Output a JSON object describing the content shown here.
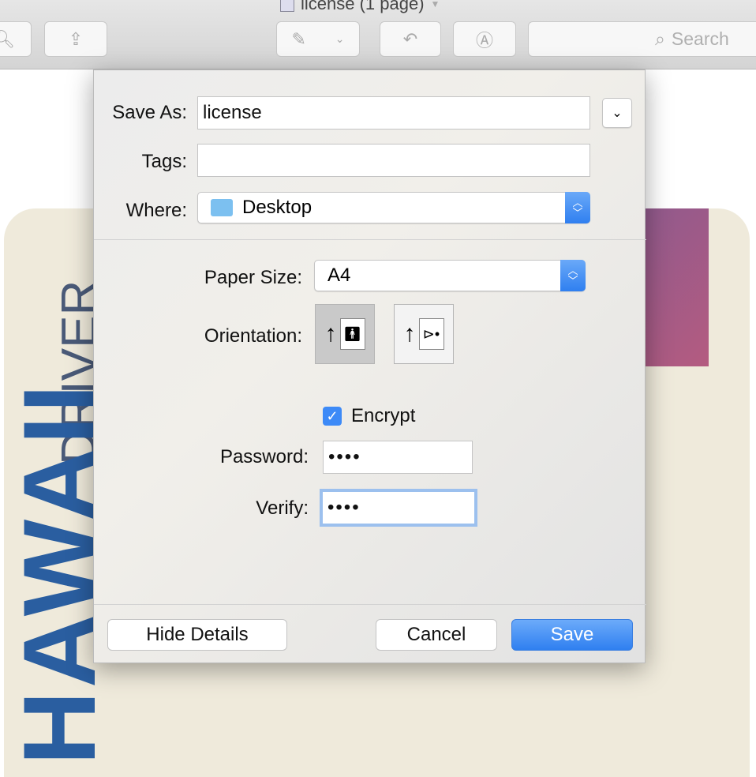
{
  "window": {
    "title": "license (1 page)"
  },
  "toolbar": {
    "search_placeholder": "Search"
  },
  "document": {
    "text_1": "DRIVER",
    "text_2": "HAWAII"
  },
  "dialog": {
    "save_as_label": "Save As:",
    "save_as_value": "license",
    "tags_label": "Tags:",
    "tags_value": "",
    "where_label": "Where:",
    "where_value": "Desktop",
    "paper_size_label": "Paper Size:",
    "paper_size_value": "A4",
    "orientation_label": "Orientation:",
    "orientation_selected": "portrait",
    "encrypt_label": "Encrypt",
    "encrypt_checked": true,
    "password_label": "Password:",
    "password_value": "••••",
    "verify_label": "Verify:",
    "verify_value": "••••",
    "hide_details": "Hide Details",
    "cancel": "Cancel",
    "save": "Save"
  },
  "colors": {
    "accent": "#3d8af7"
  }
}
